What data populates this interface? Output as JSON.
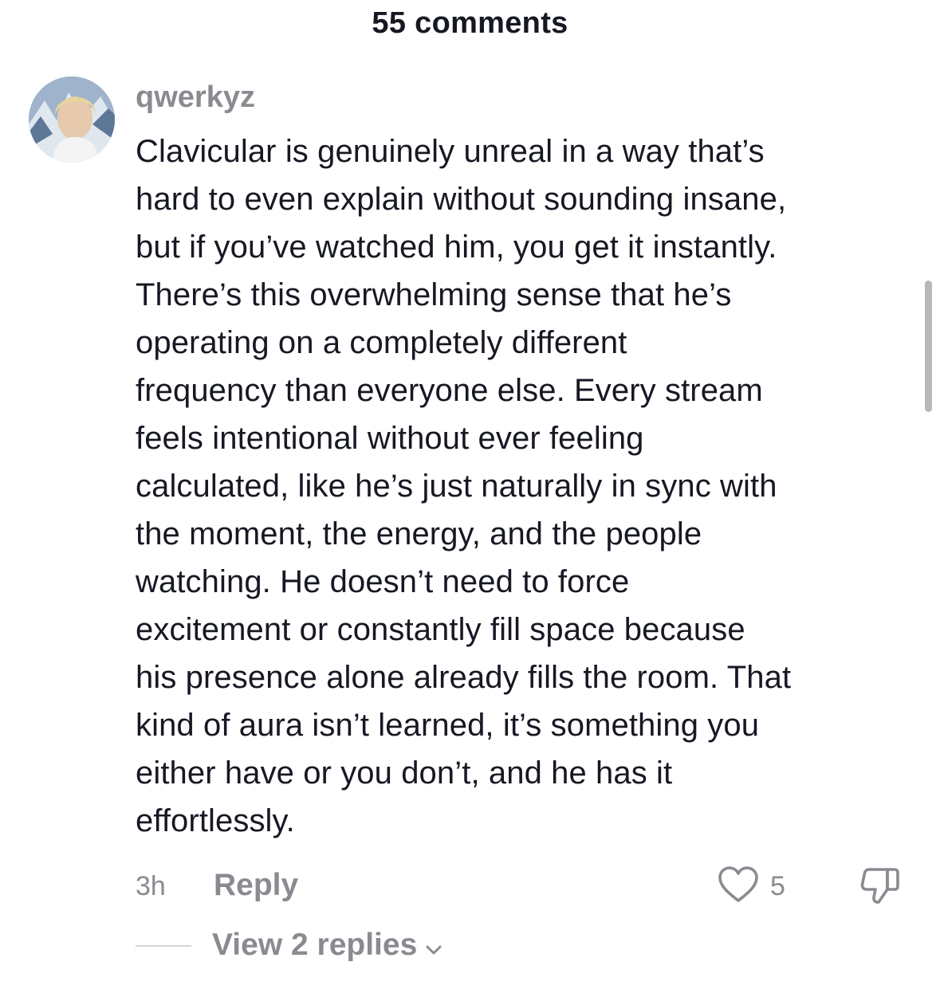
{
  "header": {
    "title": "55 comments"
  },
  "comment": {
    "username": "qwerkyz",
    "lines": [
      "Clavicular is genuinely unreal in a way that’s",
      "hard to even explain without sounding insane,",
      "but if you’ve watched him, you get it instantly.",
      "There’s this overwhelming sense that he’s",
      "operating on a completely different",
      "frequency than everyone else. Every stream",
      "feels intentional without ever feeling",
      "calculated, like he’s just naturally in sync with",
      "the moment, the energy, and the people",
      "watching. He doesn’t need to force",
      "excitement or constantly fill space because",
      "his presence alone already fills the room. That",
      "kind of aura isn’t learned, it’s something you",
      "either have or you don’t, and he has it",
      "effortlessly."
    ],
    "timestamp": "3h",
    "reply_label": "Reply",
    "like_count": "5",
    "view_replies_label": "View 2 replies"
  },
  "icons": {
    "like": "heart-outline-icon",
    "dislike": "thumbs-down-outline-icon",
    "chevron": "chevron-down-icon"
  },
  "colors": {
    "text_primary": "#161823",
    "text_secondary": "#8a8b91",
    "divider": "#d6d6d8",
    "scrollbar": "#b8b8bb"
  }
}
